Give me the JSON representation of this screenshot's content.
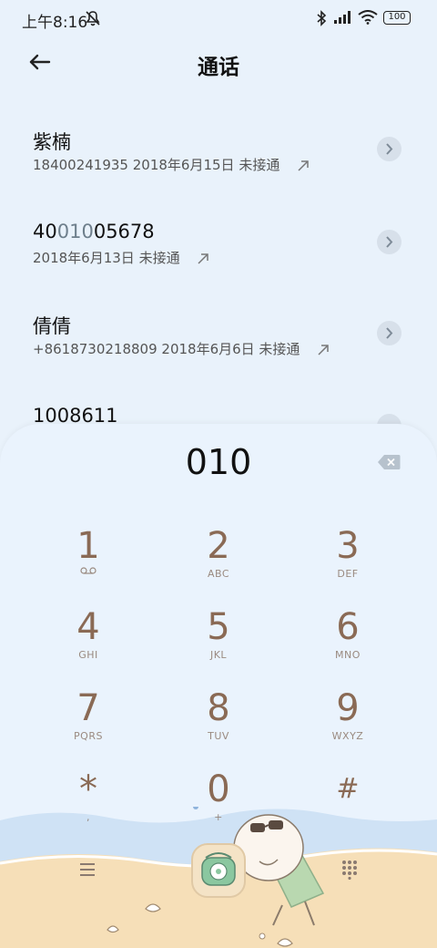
{
  "status_bar": {
    "time": "上午8:16",
    "battery": "100"
  },
  "header": {
    "title": "通话"
  },
  "calls": [
    {
      "name": "紫楠",
      "meta": "18400241935  2018年6月15日  未接通"
    },
    {
      "name_pre": "40",
      "name_hl": "010",
      "name_post": "05678",
      "meta": "2018年6月13日  未接通"
    },
    {
      "name": "倩倩",
      "meta": "+8618730218809  2018年6月6日  未接通"
    },
    {
      "name": "1008611"
    }
  ],
  "dialpad": {
    "number": "010",
    "keys": [
      {
        "digit": "1",
        "letters": ""
      },
      {
        "digit": "2",
        "letters": "ABC"
      },
      {
        "digit": "3",
        "letters": "DEF"
      },
      {
        "digit": "4",
        "letters": "GHI"
      },
      {
        "digit": "5",
        "letters": "JKL"
      },
      {
        "digit": "6",
        "letters": "MNO"
      },
      {
        "digit": "7",
        "letters": "PQRS"
      },
      {
        "digit": "8",
        "letters": "TUV"
      },
      {
        "digit": "9",
        "letters": "WXYZ"
      },
      {
        "digit": "*",
        "letters": ","
      },
      {
        "digit": "0",
        "letters": "+"
      },
      {
        "digit": "#",
        "letters": ""
      }
    ]
  },
  "colors": {
    "background": "#e9f2fb",
    "key_digit": "#8a6a55",
    "sand": "#f6dfb8",
    "sea": "#cfe2f5",
    "call_button": "#8bc7a0"
  }
}
